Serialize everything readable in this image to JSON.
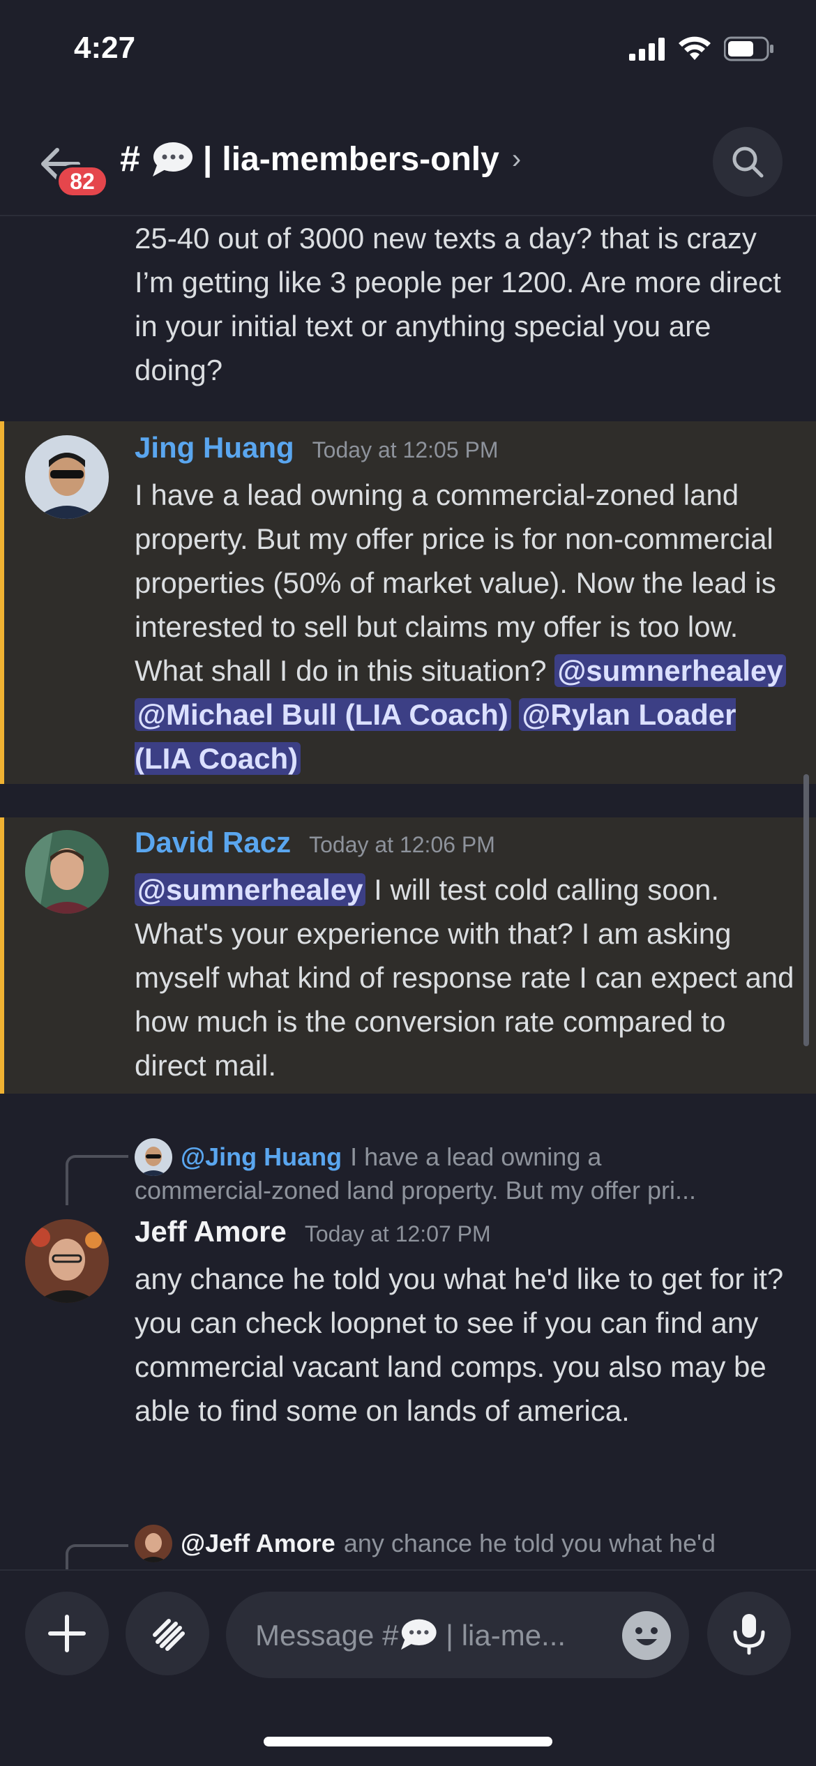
{
  "status_bar": {
    "time": "4:27"
  },
  "header": {
    "unread_count": "82",
    "hash": "#",
    "separator": "|",
    "channel_name": "lia-members-only",
    "chevron": "›"
  },
  "messages": [
    {
      "id": "partial",
      "text": "25-40 out of 3000 new texts a day? that is crazy I’m getting like 3 people per 1200. Are more direct in your initial text or anything special you are doing?"
    },
    {
      "id": "jing",
      "author": "Jing Huang",
      "timestamp": "Today at 12:05 PM",
      "text": "I have a lead owning a commercial-zoned land property.  But my offer price is for non-commercial properties (50% of market value). Now the lead is interested to sell but claims my offer is too low.  What shall I do in this situation? ",
      "mentions": [
        "@sumnerhealey",
        "@Michael Bull (LIA Coach)",
        "@Rylan Loader (LIA Coach)"
      ]
    },
    {
      "id": "david",
      "author": "David Racz",
      "timestamp": "Today at 12:06 PM",
      "mention": "@sumnerhealey",
      "text": " I will test cold calling soon. What's your experience with that? I am asking myself what kind of response rate I can expect and how much is the conversion rate compared to direct mail."
    },
    {
      "id": "jeff",
      "reply_to": "@Jing Huang",
      "reply_preview": "I have a lead owning a",
      "reply_preview_cont": "commercial-zoned land property.  But my offer pri...",
      "author": "Jeff Amore",
      "timestamp": "Today at 12:07 PM",
      "text": "any chance he told you what he'd like to get for it? you can check loopnet to see if you can find any commercial vacant land comps. you also may be able to find some on lands of america."
    },
    {
      "id": "next-reply",
      "reply_to": "@Jeff Amore",
      "reply_preview": "any chance he told you what he'd"
    }
  ],
  "composer": {
    "placeholder_prefix": "Message #",
    "placeholder_suffix": " | lia-me..."
  },
  "colors": {
    "background": "#1e1f2a",
    "highlight_bg": "#2f2d2a",
    "highlight_bar": "#f0b232",
    "mention_bg": "#3c3f85",
    "author_blue": "#5aa6ef",
    "badge_red": "#e5464c"
  },
  "icons": [
    "back-arrow-icon",
    "speech-bubble-icon",
    "search-icon",
    "plus-icon",
    "gift-icon",
    "emoji-icon",
    "microphone-icon",
    "signal-icon",
    "wifi-icon",
    "battery-icon"
  ]
}
